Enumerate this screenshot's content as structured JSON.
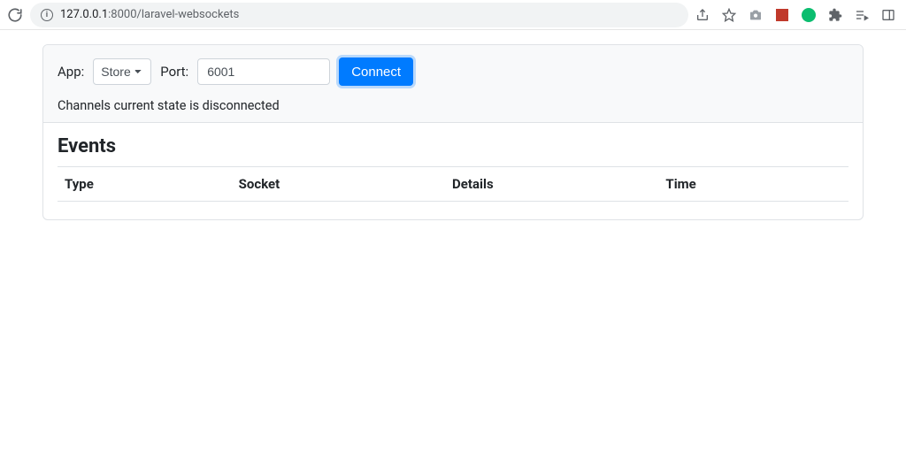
{
  "browser": {
    "url_host": "127.0.0.1",
    "url_port": ":8000",
    "url_path": "/laravel-websockets"
  },
  "form": {
    "app_label": "App:",
    "app_selected": "Store",
    "port_label": "Port:",
    "port_value": "6001",
    "connect_label": "Connect"
  },
  "status": {
    "text": "Channels current state is disconnected"
  },
  "events": {
    "title": "Events",
    "columns": {
      "type": "Type",
      "socket": "Socket",
      "details": "Details",
      "time": "Time"
    }
  }
}
